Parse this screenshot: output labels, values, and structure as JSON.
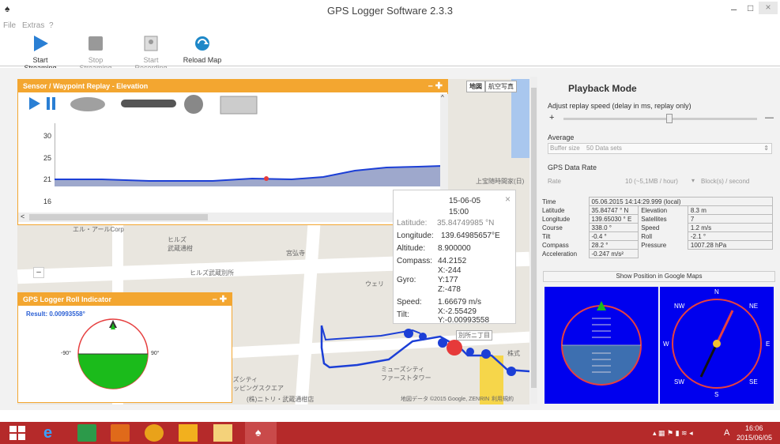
{
  "window": {
    "title": "GPS Logger Software 2.3.3",
    "controls": {
      "minimize": "–",
      "maximize": "□",
      "close": "×"
    }
  },
  "menu": {
    "items": [
      "File",
      "Extras",
      "?"
    ]
  },
  "toolbar": {
    "start_streaming": "Start Streaming",
    "stop_streaming": "Stop Streaming",
    "start_recording": "Start Recording",
    "reload_map": "Reload Map"
  },
  "map": {
    "type_buttons": [
      "地図",
      "航空写真"
    ],
    "labels": {
      "l1": "エル・アールCorp",
      "l2": "ヒルズ\n武蔵通柑",
      "l3": "ヒルズ武蔵",
      "l4": "宮弘寺",
      "l5": "ヒルズ武蔵別所",
      "l6": "ウェリ",
      "l7": "ーズシティ\nョッピングスクエア",
      "l8": "ミューズシティ\nファーストタワー",
      "l9": "(株)ニトリ・武蔵通柑店",
      "l10": "上宝随時間家(日)",
      "l11": "別所ニ丁目",
      "l12": "株式",
      "copyright": "地図データ ©2015 Google, ZENRIN",
      "terms": "利用規約"
    }
  },
  "elevation_panel": {
    "title": "Sensor / Waypoint Replay - Elevation",
    "ctl": "– ✚",
    "y_ticks": [
      "30",
      "25",
      "21",
      "16"
    ]
  },
  "popup": {
    "date": "15-06-05",
    "time": "15:00",
    "latitude_label": "Latitude:",
    "latitude": "35.84749985 °N",
    "longitude_label": "Longitude:",
    "longitude": "139.64985657°E",
    "altitude_label": "Altitude:",
    "altitude": "8.900000",
    "compass_label": "Compass:",
    "compass": "44.2152",
    "gyro_label": "Gyro:",
    "gyro_x": "X:-244",
    "gyro_y": "Y:177",
    "gyro_z": "Z:-478",
    "speed_label": "Speed:",
    "speed": "1.66679 m/s",
    "tilt_label": "Tilt:",
    "tilt_x": "X:-2.55429",
    "tilt_y": "Y:-0.00993558",
    "close": "×"
  },
  "roll_panel": {
    "title": "GPS Logger Roll Indicator",
    "ctl": "– ✚",
    "result": "Result: 0.00993558°",
    "left_tick": "-90°",
    "right_tick": "90°",
    "roll_value": 0.00993558
  },
  "playback": {
    "title": "Playback Mode",
    "replay_label": "Adjust replay speed (delay in ms, replay only)",
    "plus": "+",
    "minus": "—",
    "average_label": "Average",
    "buffer_label": "Buffer size",
    "buffer_value": "50 Data sets",
    "rate_section": "GPS Data Rate",
    "rate_label": "Rate",
    "rate_value": "10 (~5,1MB / hour)",
    "rate_unit": "Block(s) / second",
    "slider_value": 0.55,
    "time_label": "Time",
    "time_value": "05.06.2015 14:14:29.999 (local)",
    "rows": [
      {
        "k1": "Latitude",
        "v1": "35.84747 ° N",
        "k2": "Elevation",
        "v2": "8.3 m"
      },
      {
        "k1": "Longitude",
        "v1": "139.65030 ° E",
        "k2": "Satellites",
        "v2": "7"
      },
      {
        "k1": "Course",
        "v1": "338.0 °",
        "k2": "Speed",
        "v2": "1.2 m/s"
      },
      {
        "k1": "Tilt",
        "v1": "-0.4 °",
        "k2": "Roll",
        "v2": "-2.1 °"
      },
      {
        "k1": "Compass",
        "v1": "28.2 °",
        "k2": "Pressure",
        "v2": "1007.28 hPa"
      }
    ],
    "accel_label": "Acceleration",
    "accel_value": "-0.247 m/s²",
    "show_maps": "Show Position in Google Maps",
    "compass_dirs": {
      "n": "N",
      "ne": "NE",
      "e": "E",
      "se": "SE",
      "s": "S",
      "sw": "SW",
      "w": "W",
      "nw": "NW"
    }
  },
  "taskbar": {
    "time": "16:06",
    "date": "2015/06/05",
    "lang": "A"
  },
  "colors": {
    "accent_orange": "#f3a630",
    "indicator_blue": "#0000ee",
    "taskbar": "#b52a2a",
    "track_blue": "#1c3fd6"
  }
}
